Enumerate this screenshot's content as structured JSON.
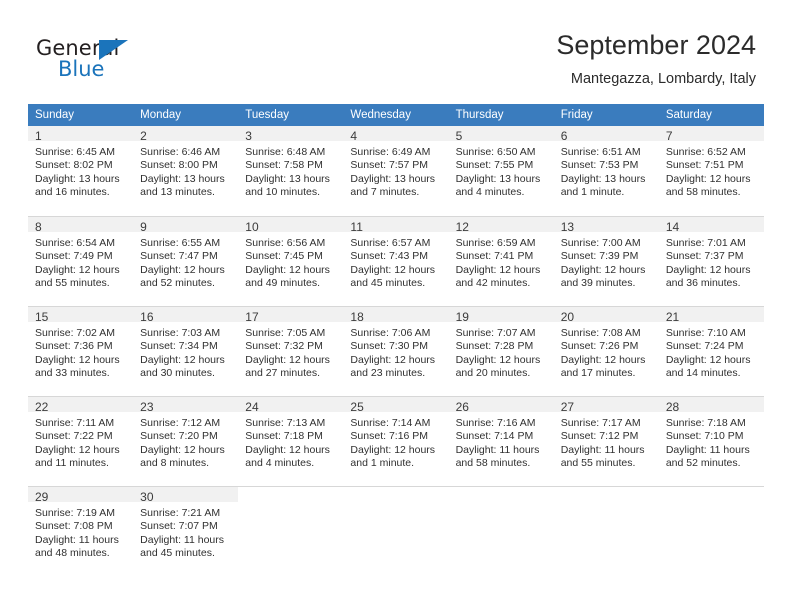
{
  "brand": {
    "name_part1": "General",
    "name_part2": "Blue",
    "triangle_color": "#1b74bb"
  },
  "header": {
    "title": "September 2024",
    "subtitle": "Mantegazza, Lombardy, Italy"
  },
  "calendar": {
    "header_bg": "#3a7cbe",
    "daynum_bg": "#f1f1f1",
    "weekdays": [
      "Sunday",
      "Monday",
      "Tuesday",
      "Wednesday",
      "Thursday",
      "Friday",
      "Saturday"
    ],
    "weeks": [
      [
        {
          "day": "1",
          "sunrise": "Sunrise: 6:45 AM",
          "sunset": "Sunset: 8:02 PM",
          "daylight_1": "Daylight: 13 hours",
          "daylight_2": "and 16 minutes."
        },
        {
          "day": "2",
          "sunrise": "Sunrise: 6:46 AM",
          "sunset": "Sunset: 8:00 PM",
          "daylight_1": "Daylight: 13 hours",
          "daylight_2": "and 13 minutes."
        },
        {
          "day": "3",
          "sunrise": "Sunrise: 6:48 AM",
          "sunset": "Sunset: 7:58 PM",
          "daylight_1": "Daylight: 13 hours",
          "daylight_2": "and 10 minutes."
        },
        {
          "day": "4",
          "sunrise": "Sunrise: 6:49 AM",
          "sunset": "Sunset: 7:57 PM",
          "daylight_1": "Daylight: 13 hours",
          "daylight_2": "and 7 minutes."
        },
        {
          "day": "5",
          "sunrise": "Sunrise: 6:50 AM",
          "sunset": "Sunset: 7:55 PM",
          "daylight_1": "Daylight: 13 hours",
          "daylight_2": "and 4 minutes."
        },
        {
          "day": "6",
          "sunrise": "Sunrise: 6:51 AM",
          "sunset": "Sunset: 7:53 PM",
          "daylight_1": "Daylight: 13 hours",
          "daylight_2": "and 1 minute."
        },
        {
          "day": "7",
          "sunrise": "Sunrise: 6:52 AM",
          "sunset": "Sunset: 7:51 PM",
          "daylight_1": "Daylight: 12 hours",
          "daylight_2": "and 58 minutes."
        }
      ],
      [
        {
          "day": "8",
          "sunrise": "Sunrise: 6:54 AM",
          "sunset": "Sunset: 7:49 PM",
          "daylight_1": "Daylight: 12 hours",
          "daylight_2": "and 55 minutes."
        },
        {
          "day": "9",
          "sunrise": "Sunrise: 6:55 AM",
          "sunset": "Sunset: 7:47 PM",
          "daylight_1": "Daylight: 12 hours",
          "daylight_2": "and 52 minutes."
        },
        {
          "day": "10",
          "sunrise": "Sunrise: 6:56 AM",
          "sunset": "Sunset: 7:45 PM",
          "daylight_1": "Daylight: 12 hours",
          "daylight_2": "and 49 minutes."
        },
        {
          "day": "11",
          "sunrise": "Sunrise: 6:57 AM",
          "sunset": "Sunset: 7:43 PM",
          "daylight_1": "Daylight: 12 hours",
          "daylight_2": "and 45 minutes."
        },
        {
          "day": "12",
          "sunrise": "Sunrise: 6:59 AM",
          "sunset": "Sunset: 7:41 PM",
          "daylight_1": "Daylight: 12 hours",
          "daylight_2": "and 42 minutes."
        },
        {
          "day": "13",
          "sunrise": "Sunrise: 7:00 AM",
          "sunset": "Sunset: 7:39 PM",
          "daylight_1": "Daylight: 12 hours",
          "daylight_2": "and 39 minutes."
        },
        {
          "day": "14",
          "sunrise": "Sunrise: 7:01 AM",
          "sunset": "Sunset: 7:37 PM",
          "daylight_1": "Daylight: 12 hours",
          "daylight_2": "and 36 minutes."
        }
      ],
      [
        {
          "day": "15",
          "sunrise": "Sunrise: 7:02 AM",
          "sunset": "Sunset: 7:36 PM",
          "daylight_1": "Daylight: 12 hours",
          "daylight_2": "and 33 minutes."
        },
        {
          "day": "16",
          "sunrise": "Sunrise: 7:03 AM",
          "sunset": "Sunset: 7:34 PM",
          "daylight_1": "Daylight: 12 hours",
          "daylight_2": "and 30 minutes."
        },
        {
          "day": "17",
          "sunrise": "Sunrise: 7:05 AM",
          "sunset": "Sunset: 7:32 PM",
          "daylight_1": "Daylight: 12 hours",
          "daylight_2": "and 27 minutes."
        },
        {
          "day": "18",
          "sunrise": "Sunrise: 7:06 AM",
          "sunset": "Sunset: 7:30 PM",
          "daylight_1": "Daylight: 12 hours",
          "daylight_2": "and 23 minutes."
        },
        {
          "day": "19",
          "sunrise": "Sunrise: 7:07 AM",
          "sunset": "Sunset: 7:28 PM",
          "daylight_1": "Daylight: 12 hours",
          "daylight_2": "and 20 minutes."
        },
        {
          "day": "20",
          "sunrise": "Sunrise: 7:08 AM",
          "sunset": "Sunset: 7:26 PM",
          "daylight_1": "Daylight: 12 hours",
          "daylight_2": "and 17 minutes."
        },
        {
          "day": "21",
          "sunrise": "Sunrise: 7:10 AM",
          "sunset": "Sunset: 7:24 PM",
          "daylight_1": "Daylight: 12 hours",
          "daylight_2": "and 14 minutes."
        }
      ],
      [
        {
          "day": "22",
          "sunrise": "Sunrise: 7:11 AM",
          "sunset": "Sunset: 7:22 PM",
          "daylight_1": "Daylight: 12 hours",
          "daylight_2": "and 11 minutes."
        },
        {
          "day": "23",
          "sunrise": "Sunrise: 7:12 AM",
          "sunset": "Sunset: 7:20 PM",
          "daylight_1": "Daylight: 12 hours",
          "daylight_2": "and 8 minutes."
        },
        {
          "day": "24",
          "sunrise": "Sunrise: 7:13 AM",
          "sunset": "Sunset: 7:18 PM",
          "daylight_1": "Daylight: 12 hours",
          "daylight_2": "and 4 minutes."
        },
        {
          "day": "25",
          "sunrise": "Sunrise: 7:14 AM",
          "sunset": "Sunset: 7:16 PM",
          "daylight_1": "Daylight: 12 hours",
          "daylight_2": "and 1 minute."
        },
        {
          "day": "26",
          "sunrise": "Sunrise: 7:16 AM",
          "sunset": "Sunset: 7:14 PM",
          "daylight_1": "Daylight: 11 hours",
          "daylight_2": "and 58 minutes."
        },
        {
          "day": "27",
          "sunrise": "Sunrise: 7:17 AM",
          "sunset": "Sunset: 7:12 PM",
          "daylight_1": "Daylight: 11 hours",
          "daylight_2": "and 55 minutes."
        },
        {
          "day": "28",
          "sunrise": "Sunrise: 7:18 AM",
          "sunset": "Sunset: 7:10 PM",
          "daylight_1": "Daylight: 11 hours",
          "daylight_2": "and 52 minutes."
        }
      ],
      [
        {
          "day": "29",
          "sunrise": "Sunrise: 7:19 AM",
          "sunset": "Sunset: 7:08 PM",
          "daylight_1": "Daylight: 11 hours",
          "daylight_2": "and 48 minutes."
        },
        {
          "day": "30",
          "sunrise": "Sunrise: 7:21 AM",
          "sunset": "Sunset: 7:07 PM",
          "daylight_1": "Daylight: 11 hours",
          "daylight_2": "and 45 minutes."
        },
        {
          "day": "",
          "sunrise": "",
          "sunset": "",
          "daylight_1": "",
          "daylight_2": ""
        },
        {
          "day": "",
          "sunrise": "",
          "sunset": "",
          "daylight_1": "",
          "daylight_2": ""
        },
        {
          "day": "",
          "sunrise": "",
          "sunset": "",
          "daylight_1": "",
          "daylight_2": ""
        },
        {
          "day": "",
          "sunrise": "",
          "sunset": "",
          "daylight_1": "",
          "daylight_2": ""
        },
        {
          "day": "",
          "sunrise": "",
          "sunset": "",
          "daylight_1": "",
          "daylight_2": ""
        }
      ]
    ]
  }
}
